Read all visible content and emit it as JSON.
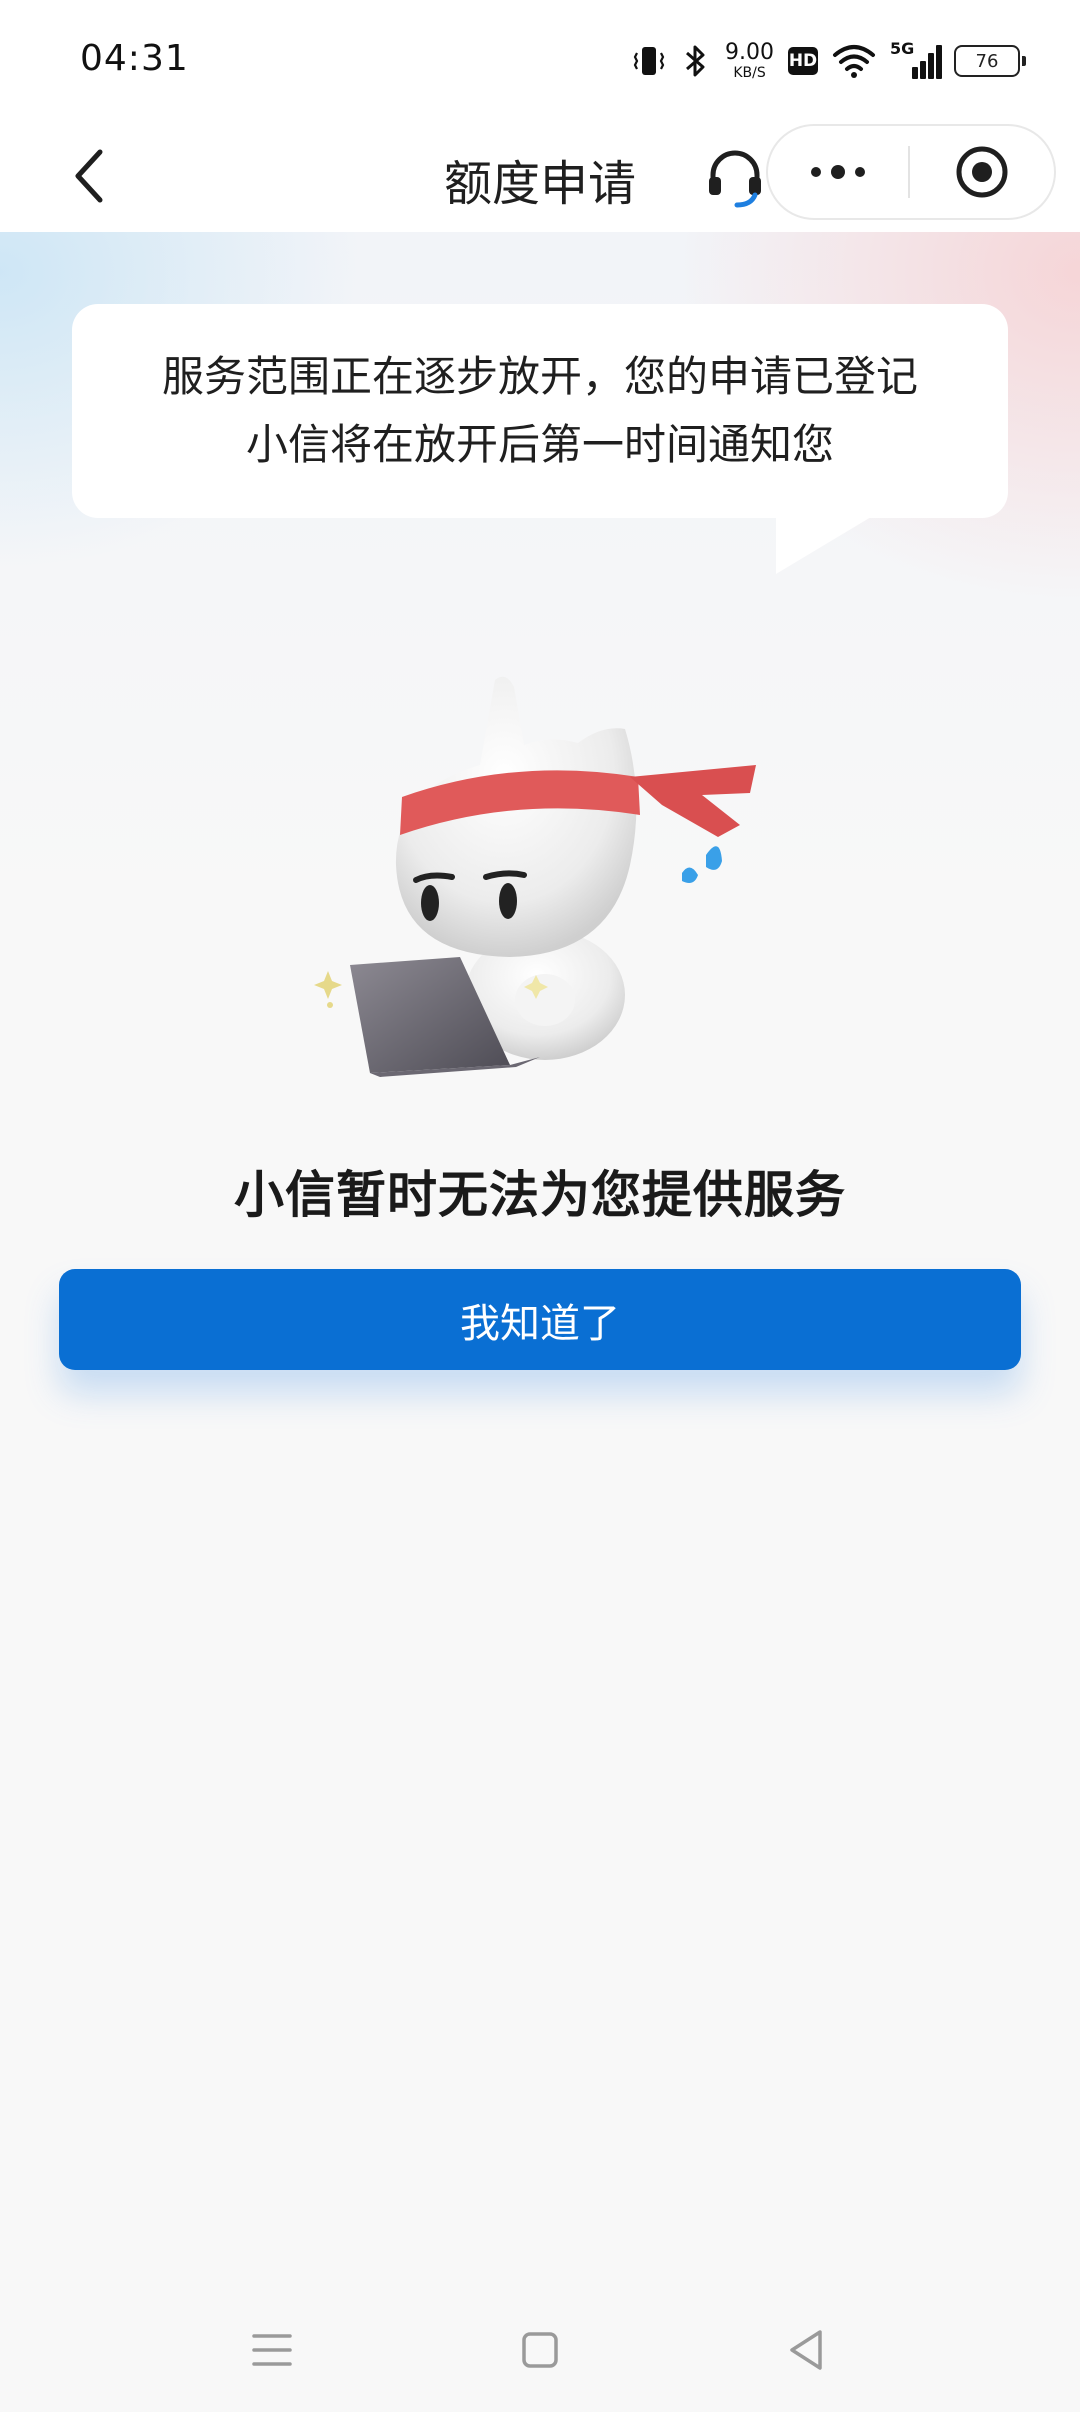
{
  "status_bar": {
    "time": "04:31",
    "net_speed_value": "9.00",
    "net_speed_unit": "KB/S",
    "hd_label": "HD",
    "network_label": "5G",
    "battery": "76"
  },
  "nav": {
    "title": "额度申请"
  },
  "bubble": {
    "line1": "服务范围正在逐步放开，您的申请已登记",
    "line2": "小信将在放开后第一时间通知您"
  },
  "result": {
    "title": "小信暂时无法为您提供服务"
  },
  "actions": {
    "ok_label": "我知道了"
  },
  "colors": {
    "primary": "#0a6fd3",
    "headband": "#e05a5a",
    "sweat": "#3aa0e8"
  }
}
